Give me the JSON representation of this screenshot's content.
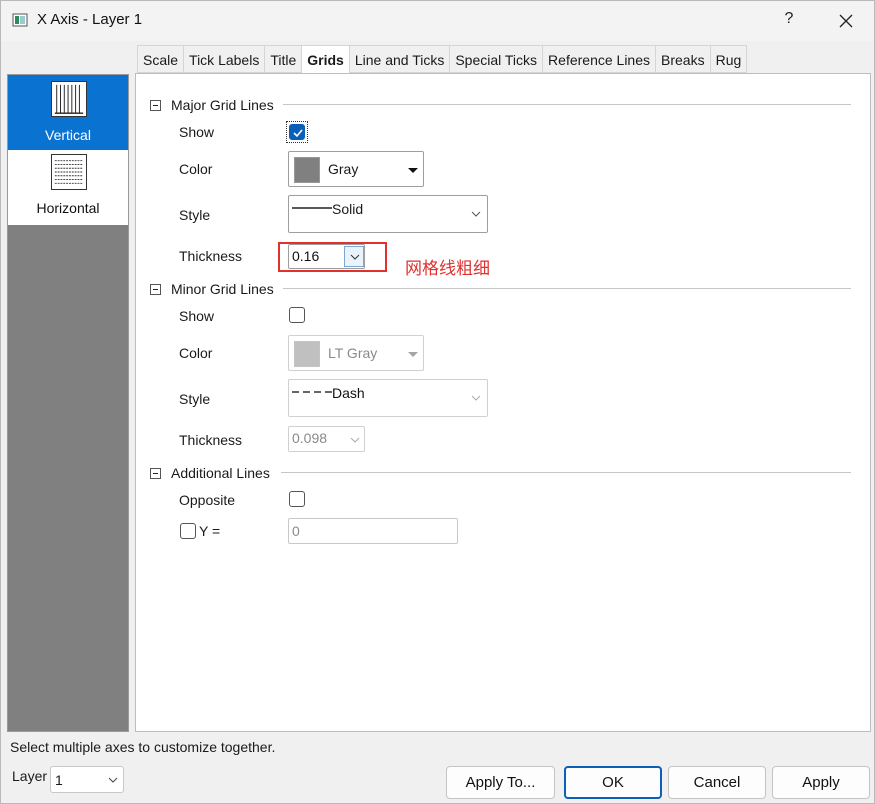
{
  "window": {
    "title": "X Axis - Layer 1",
    "help": "?"
  },
  "tabs": [
    {
      "label": "Scale",
      "active": false
    },
    {
      "label": "Tick Labels",
      "active": false
    },
    {
      "label": "Title",
      "active": false
    },
    {
      "label": "Grids",
      "active": true
    },
    {
      "label": "Line and Ticks",
      "active": false
    },
    {
      "label": "Special Ticks",
      "active": false
    },
    {
      "label": "Reference Lines",
      "active": false
    },
    {
      "label": "Breaks",
      "active": false
    },
    {
      "label": "Rug",
      "active": false
    }
  ],
  "sidebar": {
    "items": [
      {
        "label": "Vertical",
        "selected": true
      },
      {
        "label": "Horizontal",
        "selected": false
      }
    ]
  },
  "major": {
    "title": "Major Grid Lines",
    "show_label": "Show",
    "show_checked": true,
    "color_label": "Color",
    "color_value": "Gray",
    "color_hex": "#808080",
    "style_label": "Style",
    "style_value": "Solid",
    "thickness_label": "Thickness",
    "thickness_value": "0.16"
  },
  "annotation": {
    "text": "网格线粗细",
    "color": "#e0312f"
  },
  "minor": {
    "title": "Minor Grid Lines",
    "show_label": "Show",
    "show_checked": false,
    "color_label": "Color",
    "color_value": "LT Gray",
    "color_hex": "#c0c0c0",
    "style_label": "Style",
    "style_value": "Dash",
    "thickness_label": "Thickness",
    "thickness_value": "0.098"
  },
  "additional": {
    "title": "Additional Lines",
    "opposite_label": "Opposite",
    "opposite_checked": false,
    "y_label": "Y =",
    "y_checked": false,
    "y_value": "0"
  },
  "footer": {
    "hint": "Select multiple axes to customize together.",
    "layer_label": "Layer",
    "layer_value": "1",
    "apply_to": "Apply To...",
    "ok": "OK",
    "cancel": "Cancel",
    "apply": "Apply"
  },
  "colors": {
    "accent": "#0a73d1",
    "highlight": "#e0312f"
  }
}
